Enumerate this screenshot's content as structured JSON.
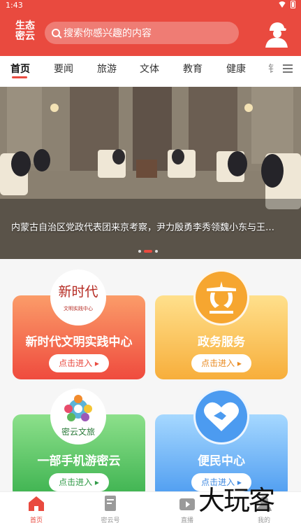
{
  "status_bar": {
    "time": "1:43"
  },
  "header": {
    "logo_line1": "生态",
    "logo_line2": "密云",
    "search_placeholder": "搜索你感兴趣的内容"
  },
  "tabs": [
    "首页",
    "要闻",
    "旅游",
    "文体",
    "教育",
    "健康",
    "钅"
  ],
  "banner": {
    "caption": "内蒙古自治区党政代表团来京考察，尹力殷勇李秀领魏小东与王…",
    "slide_index": 2,
    "slide_count": 3
  },
  "cards": [
    {
      "title": "新时代文明实践中心",
      "button": "点击进入",
      "badge_text": "新时代",
      "badge_sub": "文明实践中心"
    },
    {
      "title": "政务服务",
      "button": "点击进入"
    },
    {
      "title": "一部手机游密云",
      "button": "点击进入",
      "badge_text": "密云文旅"
    },
    {
      "title": "便民中心",
      "button": "点击进入"
    }
  ],
  "bottom_nav": [
    "首页",
    "密云号",
    "直播",
    "我的"
  ],
  "watermark": "大玩客",
  "colors": {
    "brand_red": "#e94a3f"
  }
}
